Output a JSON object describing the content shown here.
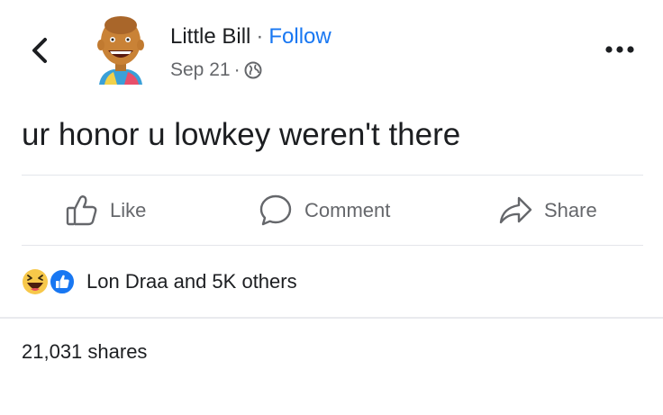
{
  "header": {
    "back_icon": "chevron-left-icon",
    "author_name": "Little Bill",
    "separator": "·",
    "follow_label": "Follow",
    "date": "Sep 21",
    "meta_separator": "·",
    "privacy_icon": "globe-icon",
    "more_icon": "more-horizontal-icon"
  },
  "post": {
    "text": "ur honor u lowkey weren't there"
  },
  "actions": {
    "like_label": "Like",
    "comment_label": "Comment",
    "share_label": "Share"
  },
  "reactions": {
    "icons": [
      "haha-emoji-icon",
      "like-reaction-icon"
    ],
    "summary": "Lon Draa and 5K others"
  },
  "shares": {
    "count_text": "21,031 shares"
  },
  "colors": {
    "accent": "#1877f2",
    "text": "#1c1e21",
    "muted": "#65676b",
    "divider": "#e4e6eb",
    "haha_yellow": "#f7c84a",
    "like_blue": "#1877f2"
  }
}
